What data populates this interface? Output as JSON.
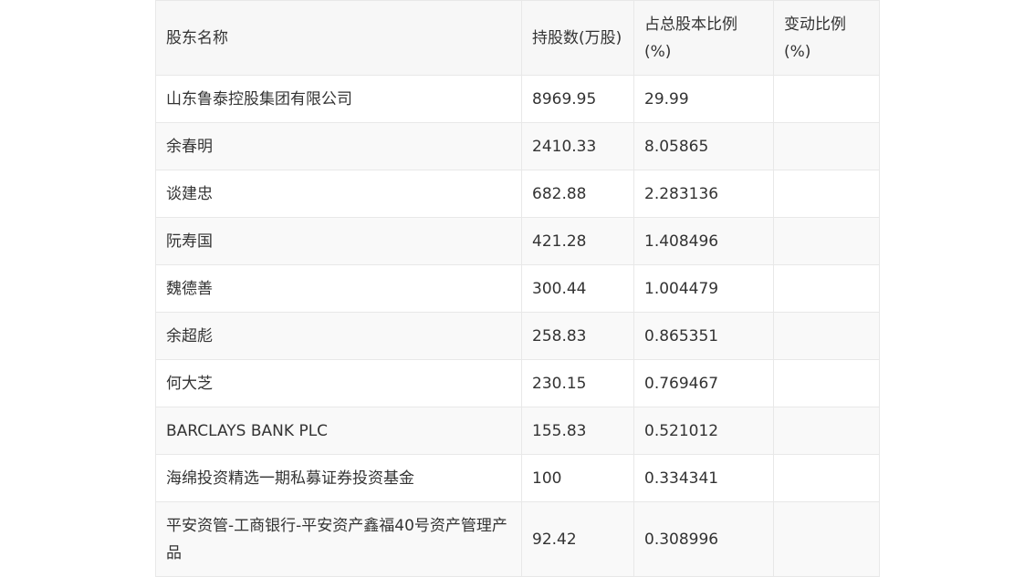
{
  "table": {
    "headers": [
      "股东名称",
      "持股数(万股)",
      "占总股本比例(%)",
      "变动比例(%)"
    ],
    "rows": [
      [
        "山东鲁泰控股集团有限公司",
        "8969.95",
        "29.99",
        ""
      ],
      [
        "余春明",
        "2410.33",
        "8.05865",
        ""
      ],
      [
        "谈建忠",
        "682.88",
        "2.283136",
        ""
      ],
      [
        "阮寿国",
        "421.28",
        "1.408496",
        ""
      ],
      [
        "魏德善",
        "300.44",
        "1.004479",
        ""
      ],
      [
        "余超彪",
        "258.83",
        "0.865351",
        ""
      ],
      [
        "何大芝",
        "230.15",
        "0.769467",
        ""
      ],
      [
        "BARCLAYS BANK PLC",
        "155.83",
        "0.521012",
        ""
      ],
      [
        "海绵投资精选一期私募证券投资基金",
        "100",
        "0.334341",
        ""
      ],
      [
        "平安资管-工商银行-平安资产鑫福40号资产管理产品",
        "92.42",
        "0.308996",
        ""
      ]
    ]
  }
}
